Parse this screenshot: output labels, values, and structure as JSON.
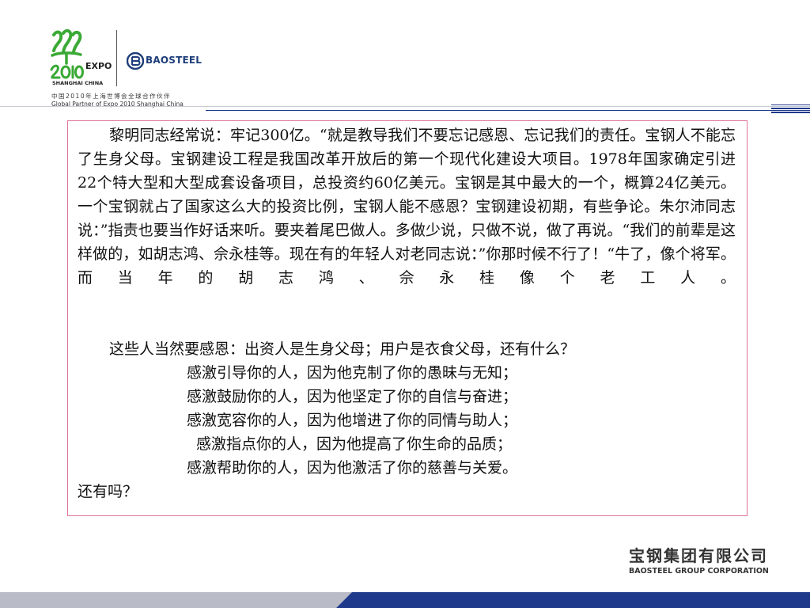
{
  "header": {
    "expo_logo": {
      "wordmark": "EXPO",
      "city": "SHANGHAI CHINA",
      "glyph_text": "世 2010"
    },
    "baosteel_logo": {
      "wordmark": "BAOSTEEL"
    },
    "partner_line_cn": "中国2010年上海世博会全球合作伙伴",
    "partner_line_en": "Global Partner of Expo 2010 Shanghai China"
  },
  "body": {
    "paragraph_1": "黎明同志经常说：牢记300亿。“就是教导我们不要忘记感恩、忘记我们的责任。宝钢人不能忘了生身父母。宝钢建设工程是我国改革开放后的第一个现代化建设大项目。1978年国家确定引进22个特大型和大型成套设备项目，总投资约60亿美元。宝钢是其中最大的一个，概算24亿美元。一个宝钢就占了国家这么大的投资比例，宝钢人能不感恩？宝钢建设初期，有些争论。朱尔沛同志说：”指责也要当作好话来听。要夹着尾巴做人。多做少说，只做不说，做了再说。“我们的前辈是这样做的，如胡志鸿、佘永桂等。现在有的年轻人对老同志说：”你那时候不行了！“牛了，像个将军。而当年的胡志鸿、佘永桂像个老工人。",
    "paragraph_2": "这些人当然要感恩：出资人是生身父母；用户是衣食父母，还有什么？",
    "gratitude_lines": [
      "感激引导你的人，因为他克制了你的愚昧与无知；",
      "感激鼓励你的人，因为他坚定了你的自信与奋进；",
      "感激宽容你的人，因为他增进了你的同情与助人；",
      "感激指点你的人，因为他提高了你生命的品质；",
      "感激帮助你的人，因为他激活了你的慈善与关爱。"
    ],
    "closing": "还有吗？"
  },
  "footer": {
    "company_cn": "宝钢集团有限公司",
    "company_en": "BAOSTEEL GROUP CORPORATION"
  },
  "colors": {
    "box_border": "#e0739a",
    "accent_navy": "#1f3a8a",
    "expo_green": "#3aa935",
    "baosteel_blue": "#1d3d7a"
  }
}
